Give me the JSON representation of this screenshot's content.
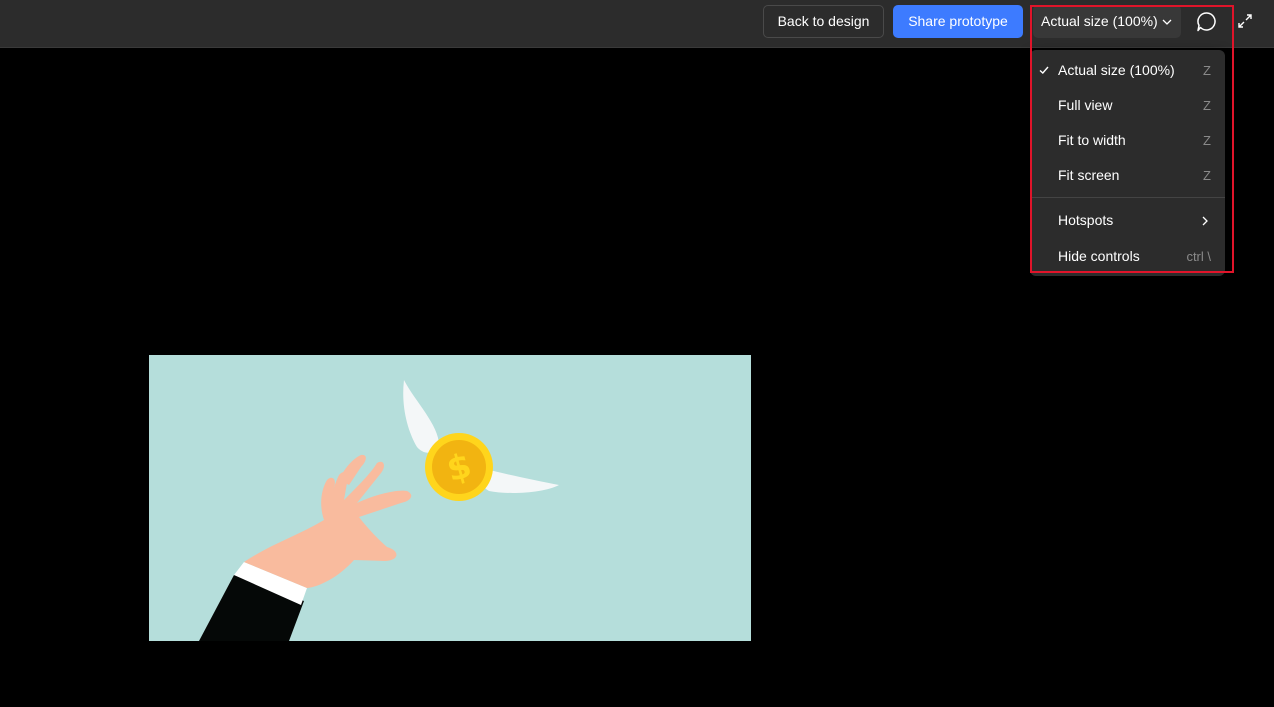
{
  "toolbar": {
    "back_label": "Back to design",
    "share_label": "Share prototype",
    "zoom_label": "Actual size (100%)",
    "comment_icon": "comment-icon",
    "expand_icon": "expand-icon"
  },
  "zoom_menu": {
    "items": [
      {
        "label": "Actual size (100%)",
        "shortcut": "Z",
        "checked": true
      },
      {
        "label": "Full view",
        "shortcut": "Z"
      },
      {
        "label": "Fit to width",
        "shortcut": "Z"
      },
      {
        "label": "Fit screen",
        "shortcut": "Z"
      },
      {
        "label": "Hotspots",
        "submenu": true
      },
      {
        "label": "Hide controls",
        "shortcut": "ctrl \\"
      }
    ]
  },
  "colors": {
    "topbar": "#2c2c2c",
    "primary_button": "#3d7bff",
    "canvas_background": "#000000",
    "frame_background": "#b5dedb",
    "highlight": "#e0142a"
  },
  "prototype_frame": {
    "illustration": "hand reaching for a winged gold dollar coin"
  }
}
